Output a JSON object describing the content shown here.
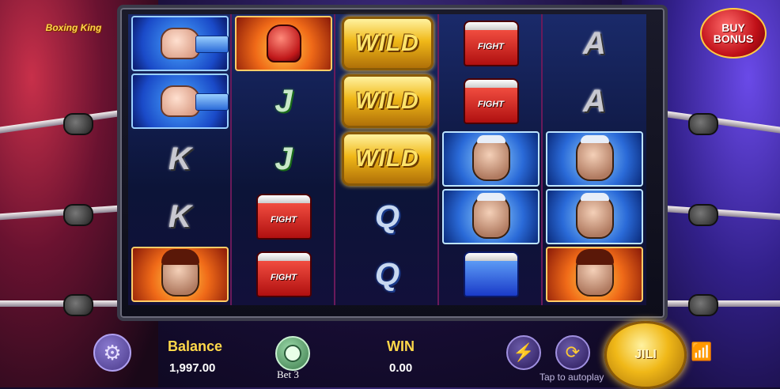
{
  "game": {
    "logo": "Boxing King",
    "buy_bonus": {
      "line1": "BUY",
      "line2": "BONUS"
    }
  },
  "reels": [
    [
      {
        "symbol": "fist",
        "icon": "fist-icon"
      },
      {
        "symbol": "fist",
        "icon": "fist-icon"
      },
      {
        "symbol": "K",
        "icon": ""
      },
      {
        "symbol": "K",
        "icon": ""
      },
      {
        "symbol": "fire-boxer",
        "icon": "boxer-face-icon"
      }
    ],
    [
      {
        "symbol": "glove",
        "icon": "boxing-glove-icon"
      },
      {
        "symbol": "J",
        "icon": ""
      },
      {
        "symbol": "J",
        "icon": ""
      },
      {
        "symbol": "shorts",
        "icon": "fight-shorts-icon",
        "text": "FIGHT"
      },
      {
        "symbol": "shorts",
        "icon": "fight-shorts-icon",
        "text": "FIGHT"
      }
    ],
    [
      {
        "symbol": "wild",
        "text": "WILD"
      },
      {
        "symbol": "wild",
        "text": "WILD"
      },
      {
        "symbol": "wild",
        "text": "WILD"
      },
      {
        "symbol": "Q",
        "icon": ""
      },
      {
        "symbol": "Q",
        "icon": ""
      }
    ],
    [
      {
        "symbol": "shorts",
        "icon": "fight-shorts-icon",
        "text": "FIGHT"
      },
      {
        "symbol": "shorts",
        "icon": "fight-shorts-icon",
        "text": "FIGHT"
      },
      {
        "symbol": "storm-boxer",
        "icon": "old-boxer-face-icon"
      },
      {
        "symbol": "storm-boxer",
        "icon": "old-boxer-face-icon"
      },
      {
        "symbol": "blue-shorts",
        "icon": "blue-shorts-icon"
      }
    ],
    [
      {
        "symbol": "A",
        "icon": ""
      },
      {
        "symbol": "A",
        "icon": ""
      },
      {
        "symbol": "storm-boxer",
        "icon": "old-boxer-face-icon"
      },
      {
        "symbol": "storm-boxer",
        "icon": "old-boxer-face-icon"
      },
      {
        "symbol": "fire-boxer",
        "icon": "boxer-face-icon"
      }
    ]
  ],
  "controls": {
    "balance_label": "Balance",
    "balance_value": "1,997.00",
    "bet_label": "Bet",
    "bet_value": "3",
    "win_label": "WIN",
    "win_value": "0.00",
    "autoplay_hint": "Tap to autoplay",
    "spin_label": "JILI"
  },
  "colors": {
    "accent_gold": "#ffd84a",
    "ring_left": "#c8304a",
    "ring_right": "#6a4ae8",
    "wifi": "#4ad84a"
  }
}
